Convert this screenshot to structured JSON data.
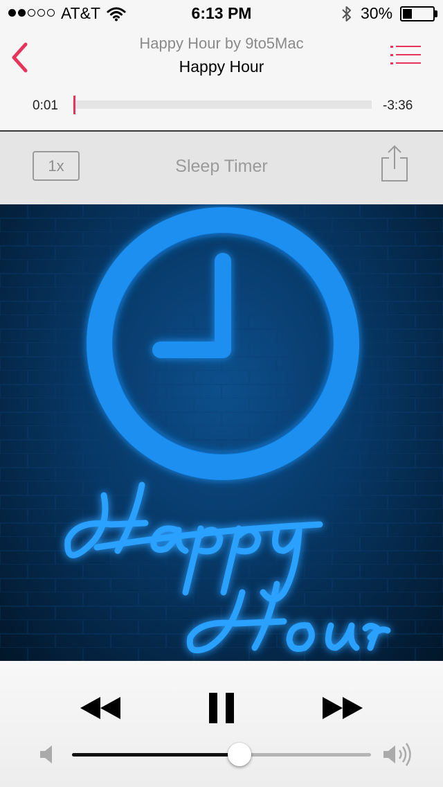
{
  "status_bar": {
    "signal_bars_filled": 2,
    "signal_bars_total": 5,
    "carrier": "AT&T",
    "wifi_icon": "wifi-icon",
    "time": "6:13 PM",
    "bluetooth_icon": "bluetooth-icon",
    "battery_percent": "30%",
    "battery_level": 0.3
  },
  "header": {
    "back_icon": "chevron-left-icon",
    "podcast_title": "Happy Hour by 9to5Mac",
    "episode_title": "Happy Hour",
    "list_icon": "episode-list-icon"
  },
  "progress": {
    "elapsed": "0:01",
    "remaining": "-3:36",
    "fraction": 0.005
  },
  "toolbar": {
    "speed_label": "1x",
    "sleep_timer_label": "Sleep Timer",
    "share_icon": "share-icon"
  },
  "artwork": {
    "description_icon": "clock-icon"
  },
  "controls": {
    "rewind_icon": "rewind-icon",
    "pause_icon": "pause-icon",
    "fast_forward_icon": "fast-forward-icon",
    "volume_min_icon": "volume-min-icon",
    "volume_max_icon": "volume-max-icon",
    "volume_level": 0.56
  },
  "colors": {
    "accent": "#e8345a",
    "toolbar_bg": "#e6e5e5",
    "artwork_neon": "#1e90f0"
  }
}
